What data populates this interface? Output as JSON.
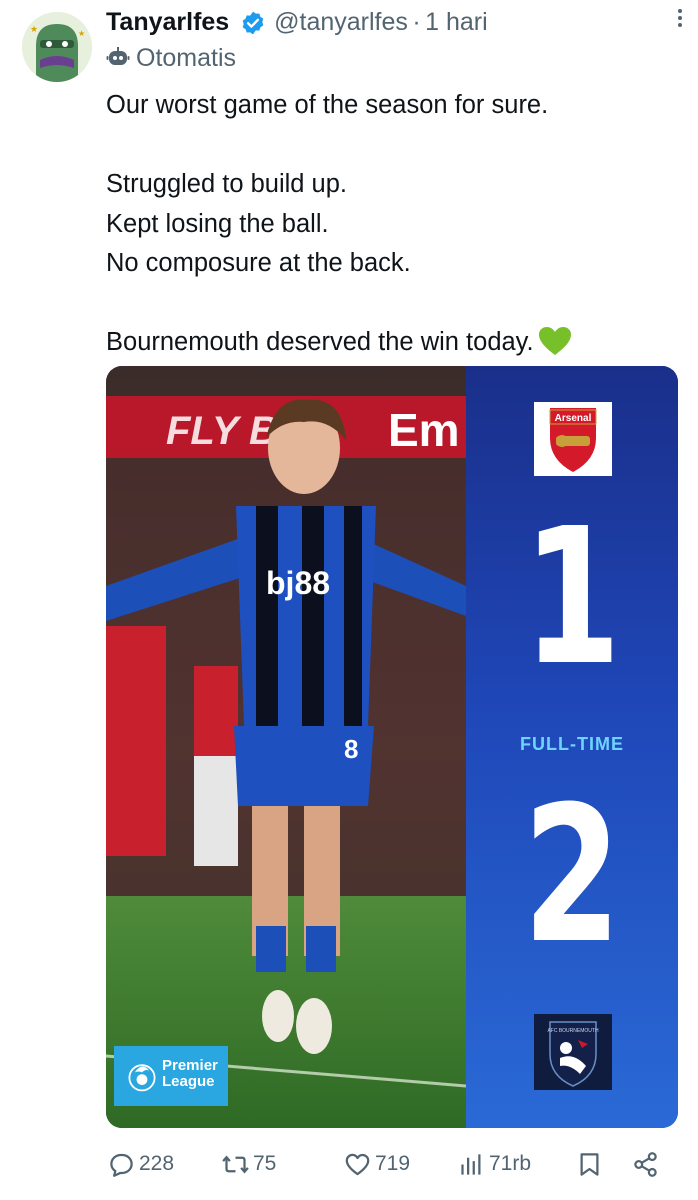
{
  "tweet": {
    "display_name": "Tanyarlfes",
    "handle": "@tanyarlfes",
    "separator": "·",
    "time": "1 hari",
    "automated_label": "Otomatis",
    "lines": [
      "Our worst game of the season for sure.",
      "",
      "Struggled to build up.",
      "Kept losing the ball.",
      "No composure at the back.",
      "",
      "Bournemouth deserved the win today."
    ]
  },
  "media": {
    "shirt_sponsor": "bj88",
    "banner_text_left": "FLY BE",
    "banner_text_right": "Em",
    "shirt_number": "8",
    "home_crest_label": "Arsenal",
    "home_score": "1",
    "status": "FULL-TIME",
    "away_score": "2",
    "away_crest_label": "AFC BOURNEMOUTH",
    "league_line1": "Premier",
    "league_line2": "League"
  },
  "actions": {
    "replies": "228",
    "reposts": "75",
    "likes": "719",
    "views": "71rb"
  },
  "colors": {
    "verified": "#1d9bf0",
    "muted": "#536471",
    "heart": "#78c02a",
    "panel_blue": "#1f47b8",
    "fulltime_cyan": "#6fd3ff"
  }
}
